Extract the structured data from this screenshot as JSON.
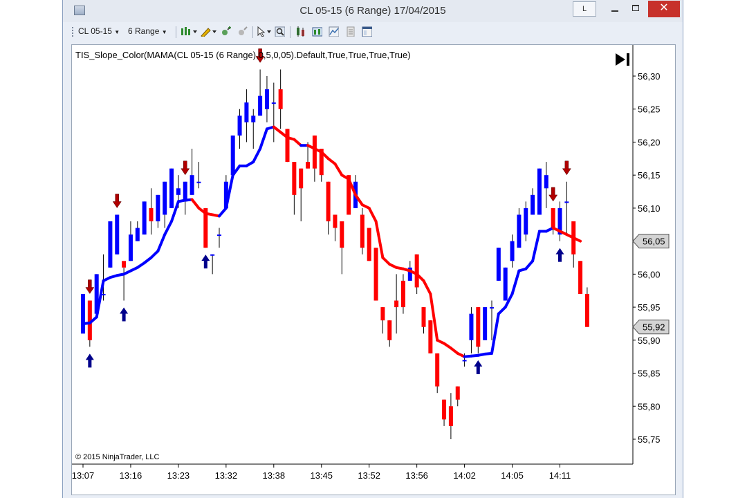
{
  "window": {
    "title": "CL 05-15 (6 Range)  17/04/2015",
    "link_button": "L",
    "close_glyph": "✕"
  },
  "toolbar": {
    "instrument": "CL 05-15",
    "interval": "6 Range",
    "icons": [
      "bar-type-icon",
      "drawing-pencil-icon",
      "zoom-in-icon",
      "zoom-out-icon",
      "cursor-icon",
      "magnifier-icon",
      "chart-style-icon",
      "data-box-icon",
      "indicators-icon",
      "strategies-icon",
      "properties-icon"
    ]
  },
  "chart": {
    "indicator_label": "TIS_Slope_Color(MAMA(CL 05-15 (6 Range),0,5,0,05).Default,True,True,True,True)",
    "copyright": "© 2015 NinjaTrader, LLC",
    "colors": {
      "up": "#0000ff",
      "down": "#ff0000",
      "arrow_up": "#00008b",
      "arrow_down": "#b00000",
      "line_up": "#0000ff",
      "line_down": "#ff0000",
      "tag_bg": "#d4d4d4"
    }
  },
  "chart_data": {
    "type": "candlestick",
    "title": "",
    "ylim": [
      55.72,
      56.33
    ],
    "y_ticks": [
      "56,30",
      "56,25",
      "56,20",
      "56,15",
      "56,10",
      "56,05",
      "56,00",
      "55,95",
      "55,90",
      "55,85",
      "55,80",
      "55,75"
    ],
    "y_tick_values": [
      56.3,
      56.25,
      56.2,
      56.15,
      56.1,
      56.05,
      56.0,
      55.95,
      55.9,
      55.85,
      55.8,
      55.75
    ],
    "price_tags": [
      {
        "label": "56,05",
        "value": 56.05
      },
      {
        "label": "55,92",
        "value": 55.92
      }
    ],
    "x_ticks": [
      {
        "label": "13:07",
        "bar": 0
      },
      {
        "label": "13:16",
        "bar": 7
      },
      {
        "label": "13:23",
        "bar": 14
      },
      {
        "label": "13:32",
        "bar": 21
      },
      {
        "label": "13:38",
        "bar": 28
      },
      {
        "label": "13:45",
        "bar": 35
      },
      {
        "label": "13:52",
        "bar": 42
      },
      {
        "label": "13:56",
        "bar": 49
      },
      {
        "label": "14:02",
        "bar": 56
      },
      {
        "label": "14:05",
        "bar": 63
      },
      {
        "label": "14:11",
        "bar": 70
      }
    ],
    "bars": [
      {
        "o": 55.91,
        "h": 55.97,
        "l": 55.91,
        "c": 55.97
      },
      {
        "o": 55.96,
        "h": 55.96,
        "l": 55.89,
        "c": 55.9
      },
      {
        "o": 55.94,
        "h": 56.0,
        "l": 55.94,
        "c": 56.0
      },
      {
        "o": 55.97,
        "h": 56.03,
        "l": 55.96,
        "c": 55.97
      },
      {
        "o": 56.01,
        "h": 56.08,
        "l": 56.01,
        "c": 56.08
      },
      {
        "o": 56.03,
        "h": 56.09,
        "l": 56.03,
        "c": 56.09
      },
      {
        "o": 56.02,
        "h": 56.01,
        "l": 55.96,
        "c": 56.01
      },
      {
        "o": 56.02,
        "h": 56.08,
        "l": 56.02,
        "c": 56.06
      },
      {
        "o": 56.05,
        "h": 56.08,
        "l": 56.05,
        "c": 56.07
      },
      {
        "o": 56.06,
        "h": 56.11,
        "l": 56.06,
        "c": 56.11
      },
      {
        "o": 56.1,
        "h": 56.13,
        "l": 56.06,
        "c": 56.08
      },
      {
        "o": 56.08,
        "h": 56.12,
        "l": 56.07,
        "c": 56.12
      },
      {
        "o": 56.09,
        "h": 56.14,
        "l": 56.07,
        "c": 56.14
      },
      {
        "o": 56.1,
        "h": 56.16,
        "l": 56.1,
        "c": 56.16
      },
      {
        "o": 56.12,
        "h": 56.15,
        "l": 56.1,
        "c": 56.13
      },
      {
        "o": 56.11,
        "h": 56.14,
        "l": 56.09,
        "c": 56.14
      },
      {
        "o": 56.12,
        "h": 56.19,
        "l": 56.12,
        "c": 56.15
      },
      {
        "o": 56.14,
        "h": 56.17,
        "l": 56.13,
        "c": 56.14
      },
      {
        "o": 56.1,
        "h": 56.1,
        "l": 56.04,
        "c": 56.04
      },
      {
        "o": 56.03,
        "h": 56.03,
        "l": 56.0,
        "c": 56.03
      },
      {
        "o": 56.06,
        "h": 56.07,
        "l": 56.04,
        "c": 56.06
      },
      {
        "o": 56.1,
        "h": 56.15,
        "l": 56.1,
        "c": 56.14
      },
      {
        "o": 56.15,
        "h": 56.21,
        "l": 56.15,
        "c": 56.21
      },
      {
        "o": 56.21,
        "h": 56.25,
        "l": 56.19,
        "c": 56.24
      },
      {
        "o": 56.23,
        "h": 56.28,
        "l": 56.2,
        "c": 56.26
      },
      {
        "o": 56.23,
        "h": 56.25,
        "l": 56.19,
        "c": 56.24
      },
      {
        "o": 56.24,
        "h": 56.31,
        "l": 56.24,
        "c": 56.27
      },
      {
        "o": 56.25,
        "h": 56.3,
        "l": 56.23,
        "c": 56.28
      },
      {
        "o": 56.26,
        "h": 56.29,
        "l": 56.2,
        "c": 56.26
      },
      {
        "o": 56.28,
        "h": 56.31,
        "l": 56.22,
        "c": 56.25
      },
      {
        "o": 56.22,
        "h": 56.22,
        "l": 56.17,
        "c": 56.17
      },
      {
        "o": 56.17,
        "h": 56.17,
        "l": 56.09,
        "c": 56.12
      },
      {
        "o": 56.16,
        "h": 56.16,
        "l": 56.08,
        "c": 56.13
      },
      {
        "o": 56.17,
        "h": 56.2,
        "l": 56.16,
        "c": 56.16
      },
      {
        "o": 56.21,
        "h": 56.21,
        "l": 56.14,
        "c": 56.16
      },
      {
        "o": 56.19,
        "h": 56.19,
        "l": 56.14,
        "c": 56.15
      },
      {
        "o": 56.14,
        "h": 56.14,
        "l": 56.06,
        "c": 56.08
      },
      {
        "o": 56.09,
        "h": 56.09,
        "l": 56.05,
        "c": 56.07
      },
      {
        "o": 56.08,
        "h": 56.08,
        "l": 56.0,
        "c": 56.04
      },
      {
        "o": 56.15,
        "h": 56.15,
        "l": 56.09,
        "c": 56.09
      },
      {
        "o": 56.1,
        "h": 56.15,
        "l": 56.1,
        "c": 56.14
      },
      {
        "o": 56.09,
        "h": 56.1,
        "l": 56.03,
        "c": 56.04
      },
      {
        "o": 56.07,
        "h": 56.07,
        "l": 56.02,
        "c": 56.02
      },
      {
        "o": 56.04,
        "h": 56.04,
        "l": 55.96,
        "c": 55.96
      },
      {
        "o": 55.95,
        "h": 55.95,
        "l": 55.91,
        "c": 55.93
      },
      {
        "o": 55.93,
        "h": 55.93,
        "l": 55.89,
        "c": 55.9
      },
      {
        "o": 55.96,
        "h": 56.0,
        "l": 55.91,
        "c": 55.95
      },
      {
        "o": 55.99,
        "h": 56.0,
        "l": 55.94,
        "c": 55.95
      },
      {
        "o": 55.99,
        "h": 56.02,
        "l": 55.99,
        "c": 56.01
      },
      {
        "o": 56.03,
        "h": 56.03,
        "l": 55.97,
        "c": 55.98
      },
      {
        "o": 55.95,
        "h": 55.95,
        "l": 55.91,
        "c": 55.92
      },
      {
        "o": 55.93,
        "h": 55.93,
        "l": 55.88,
        "c": 55.88
      },
      {
        "o": 55.88,
        "h": 55.88,
        "l": 55.82,
        "c": 55.83
      },
      {
        "o": 55.81,
        "h": 55.81,
        "l": 55.77,
        "c": 55.78
      },
      {
        "o": 55.8,
        "h": 55.82,
        "l": 55.75,
        "c": 55.77
      },
      {
        "o": 55.83,
        "h": 55.83,
        "l": 55.8,
        "c": 55.81
      },
      {
        "o": 55.87,
        "h": 55.88,
        "l": 55.86,
        "c": 55.87
      },
      {
        "o": 55.9,
        "h": 55.95,
        "l": 55.88,
        "c": 55.94
      },
      {
        "o": 55.95,
        "h": 55.95,
        "l": 55.88,
        "c": 55.89
      },
      {
        "o": 55.9,
        "h": 55.95,
        "l": 55.9,
        "c": 55.95
      },
      {
        "o": 55.95,
        "h": 55.96,
        "l": 55.9,
        "c": 55.95
      },
      {
        "o": 55.99,
        "h": 56.04,
        "l": 55.99,
        "c": 56.04
      },
      {
        "o": 55.96,
        "h": 56.01,
        "l": 55.96,
        "c": 56.01
      },
      {
        "o": 56.02,
        "h": 56.06,
        "l": 56.01,
        "c": 56.05
      },
      {
        "o": 56.04,
        "h": 56.1,
        "l": 56.04,
        "c": 56.09
      },
      {
        "o": 56.06,
        "h": 56.11,
        "l": 56.05,
        "c": 56.1
      },
      {
        "o": 56.09,
        "h": 56.13,
        "l": 56.09,
        "c": 56.12
      },
      {
        "o": 56.09,
        "h": 56.16,
        "l": 56.09,
        "c": 56.16
      },
      {
        "o": 56.13,
        "h": 56.17,
        "l": 56.1,
        "c": 56.15
      },
      {
        "o": 56.1,
        "h": 56.1,
        "l": 56.06,
        "c": 56.07
      },
      {
        "o": 56.06,
        "h": 56.11,
        "l": 56.05,
        "c": 56.1
      },
      {
        "o": 56.11,
        "h": 56.14,
        "l": 56.06,
        "c": 56.11
      },
      {
        "o": 56.08,
        "h": 56.08,
        "l": 56.01,
        "c": 56.03
      },
      {
        "o": 56.02,
        "h": 56.02,
        "l": 55.97,
        "c": 55.97
      },
      {
        "o": 55.97,
        "h": 55.98,
        "l": 55.92,
        "c": 55.92
      }
    ],
    "mama_line": [
      55.925,
      55.926,
      55.935,
      55.99,
      55.995,
      55.998,
      56.0,
      56.005,
      56.01,
      56.017,
      56.025,
      56.035,
      56.06,
      56.08,
      56.11,
      56.112,
      56.113,
      56.1,
      56.092,
      56.09,
      56.088,
      56.1,
      56.15,
      56.164,
      56.164,
      56.17,
      56.19,
      56.22,
      56.223,
      56.215,
      56.207,
      56.204,
      56.195,
      56.195,
      56.19,
      56.185,
      56.175,
      56.167,
      56.15,
      56.144,
      56.12,
      56.105,
      56.1,
      56.08,
      56.025,
      56.015,
      56.01,
      56.008,
      56.005,
      56.0,
      55.99,
      55.97,
      55.9,
      55.895,
      55.888,
      55.88,
      55.875,
      55.876,
      55.877,
      55.879,
      55.88,
      55.94,
      55.95,
      55.97,
      56.005,
      56.008,
      56.02,
      56.065,
      56.065,
      56.07,
      56.065,
      56.06,
      56.055,
      56.05
    ],
    "up_arrows": [
      1,
      6,
      18,
      58,
      70
    ],
    "down_arrows": [
      1,
      5,
      15,
      26,
      69,
      71
    ]
  }
}
